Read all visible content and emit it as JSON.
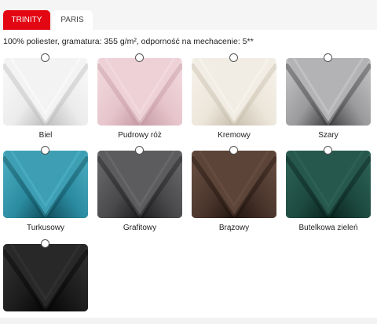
{
  "tabs": [
    {
      "label": "TRINITY",
      "active": true
    },
    {
      "label": "PARIS",
      "active": false
    }
  ],
  "description": "100% poliester, gramatura: 355 g/m², odporność na mechacenie: 5**",
  "accent_color": "#e30613",
  "fabrics": [
    {
      "name": "Biel",
      "base": "#ececec",
      "light": "#fafafa",
      "dark": "#bdbdbd",
      "selected": false
    },
    {
      "name": "Pudrowy róż",
      "base": "#e6c4cb",
      "light": "#f3dde2",
      "dark": "#c59aa4",
      "selected": false
    },
    {
      "name": "Kremowy",
      "base": "#ece6da",
      "light": "#f7f3ec",
      "dark": "#c8bfae",
      "selected": false
    },
    {
      "name": "Szary",
      "base": "#9a9a9c",
      "light": "#c8c8ca",
      "dark": "#3e3e40",
      "selected": false
    },
    {
      "name": "Turkusowy",
      "base": "#2b8ba0",
      "light": "#4fb0c4",
      "dark": "#0f4c5a",
      "selected": false
    },
    {
      "name": "Grafitowy",
      "base": "#4a4a4c",
      "light": "#6c6c6e",
      "dark": "#1e1e20",
      "selected": false
    },
    {
      "name": "Brązowy",
      "base": "#4a352c",
      "light": "#6b5044",
      "dark": "#22160f",
      "selected": false
    },
    {
      "name": "Butelkowa zieleń",
      "base": "#1d4a40",
      "light": "#2f6558",
      "dark": "#0a231d",
      "selected": false
    },
    {
      "name": "",
      "base": "#1c1c1c",
      "light": "#333333",
      "dark": "#050505",
      "selected": false
    }
  ]
}
